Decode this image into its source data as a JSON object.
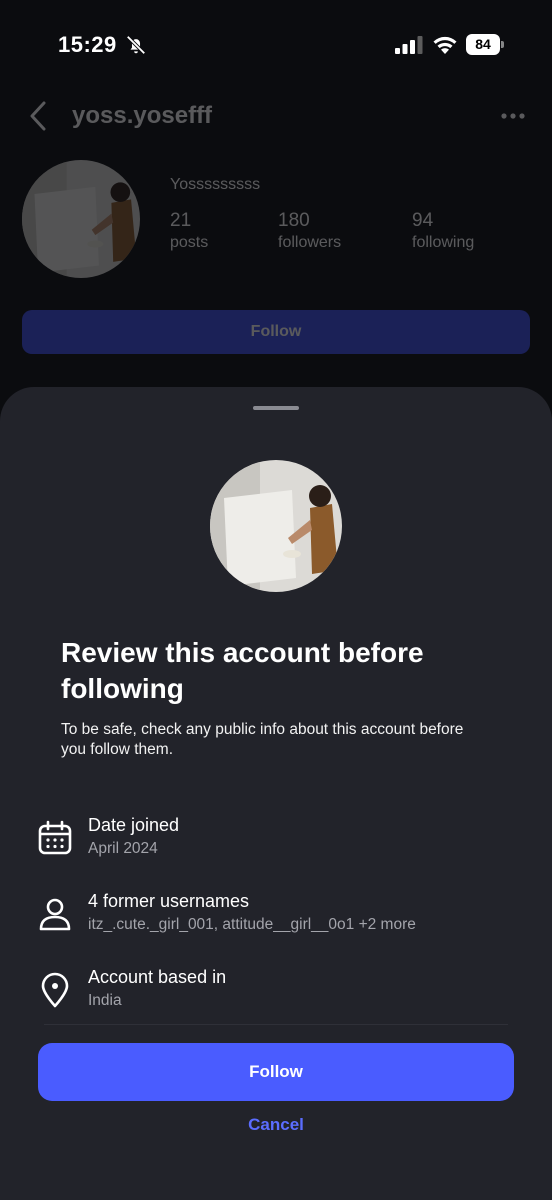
{
  "status_bar": {
    "time": "15:29",
    "battery": "84",
    "icons": [
      "bell-slash-icon",
      "signal-icon",
      "wifi-icon",
      "battery-icon"
    ]
  },
  "profile": {
    "username": "yoss.yosefff",
    "display_name": "Yosssssssss",
    "stats": [
      {
        "value": "21",
        "label": "posts"
      },
      {
        "value": "180",
        "label": "followers"
      },
      {
        "value": "94",
        "label": "following"
      }
    ],
    "follow_label": "Follow"
  },
  "sheet": {
    "title": "Review this account before following",
    "description": "To be safe, check any public info about this account before you follow them.",
    "info": [
      {
        "icon": "calendar-icon",
        "label": "Date joined",
        "value": "April 2024"
      },
      {
        "icon": "person-icon",
        "label": "4 former usernames",
        "value": "itz_.cute._girl_001, attitude__girl__0o1 +2 more"
      },
      {
        "icon": "location-pin-icon",
        "label": "Account based in",
        "value": "India"
      }
    ],
    "follow_button": "Follow",
    "cancel_button": "Cancel"
  },
  "colors": {
    "accent": "#4a5cff",
    "sheet_bg": "#22232a",
    "page_bg": "#0b0c0f",
    "cancel_text": "#5b6dff"
  }
}
